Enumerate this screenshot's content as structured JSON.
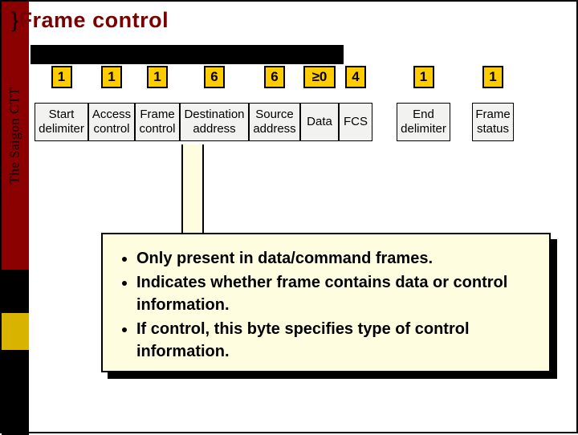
{
  "sidebar": {
    "label": "The Saigon CTT"
  },
  "title": {
    "brace": "}",
    "text": "Frame control"
  },
  "fields": {
    "sd": {
      "num": "1",
      "label": "Start delimiter"
    },
    "ac": {
      "num": "1",
      "label": "Access control"
    },
    "fc": {
      "num": "1",
      "label": "Frame control"
    },
    "da": {
      "num": "6",
      "label": "Destination address"
    },
    "sa": {
      "num": "6",
      "label": "Source address"
    },
    "dt": {
      "num": "≥0",
      "label": "Data"
    },
    "fs": {
      "num": "4",
      "label": "FCS"
    },
    "ed": {
      "num": "1",
      "label": "End delimiter"
    },
    "fr": {
      "num": "1",
      "label": "Frame status"
    }
  },
  "callout": {
    "b1": "Only present in data/command frames.",
    "b2": "Indicates whether frame contains data or control information.",
    "b3": "If control, this byte specifies type of control information."
  }
}
